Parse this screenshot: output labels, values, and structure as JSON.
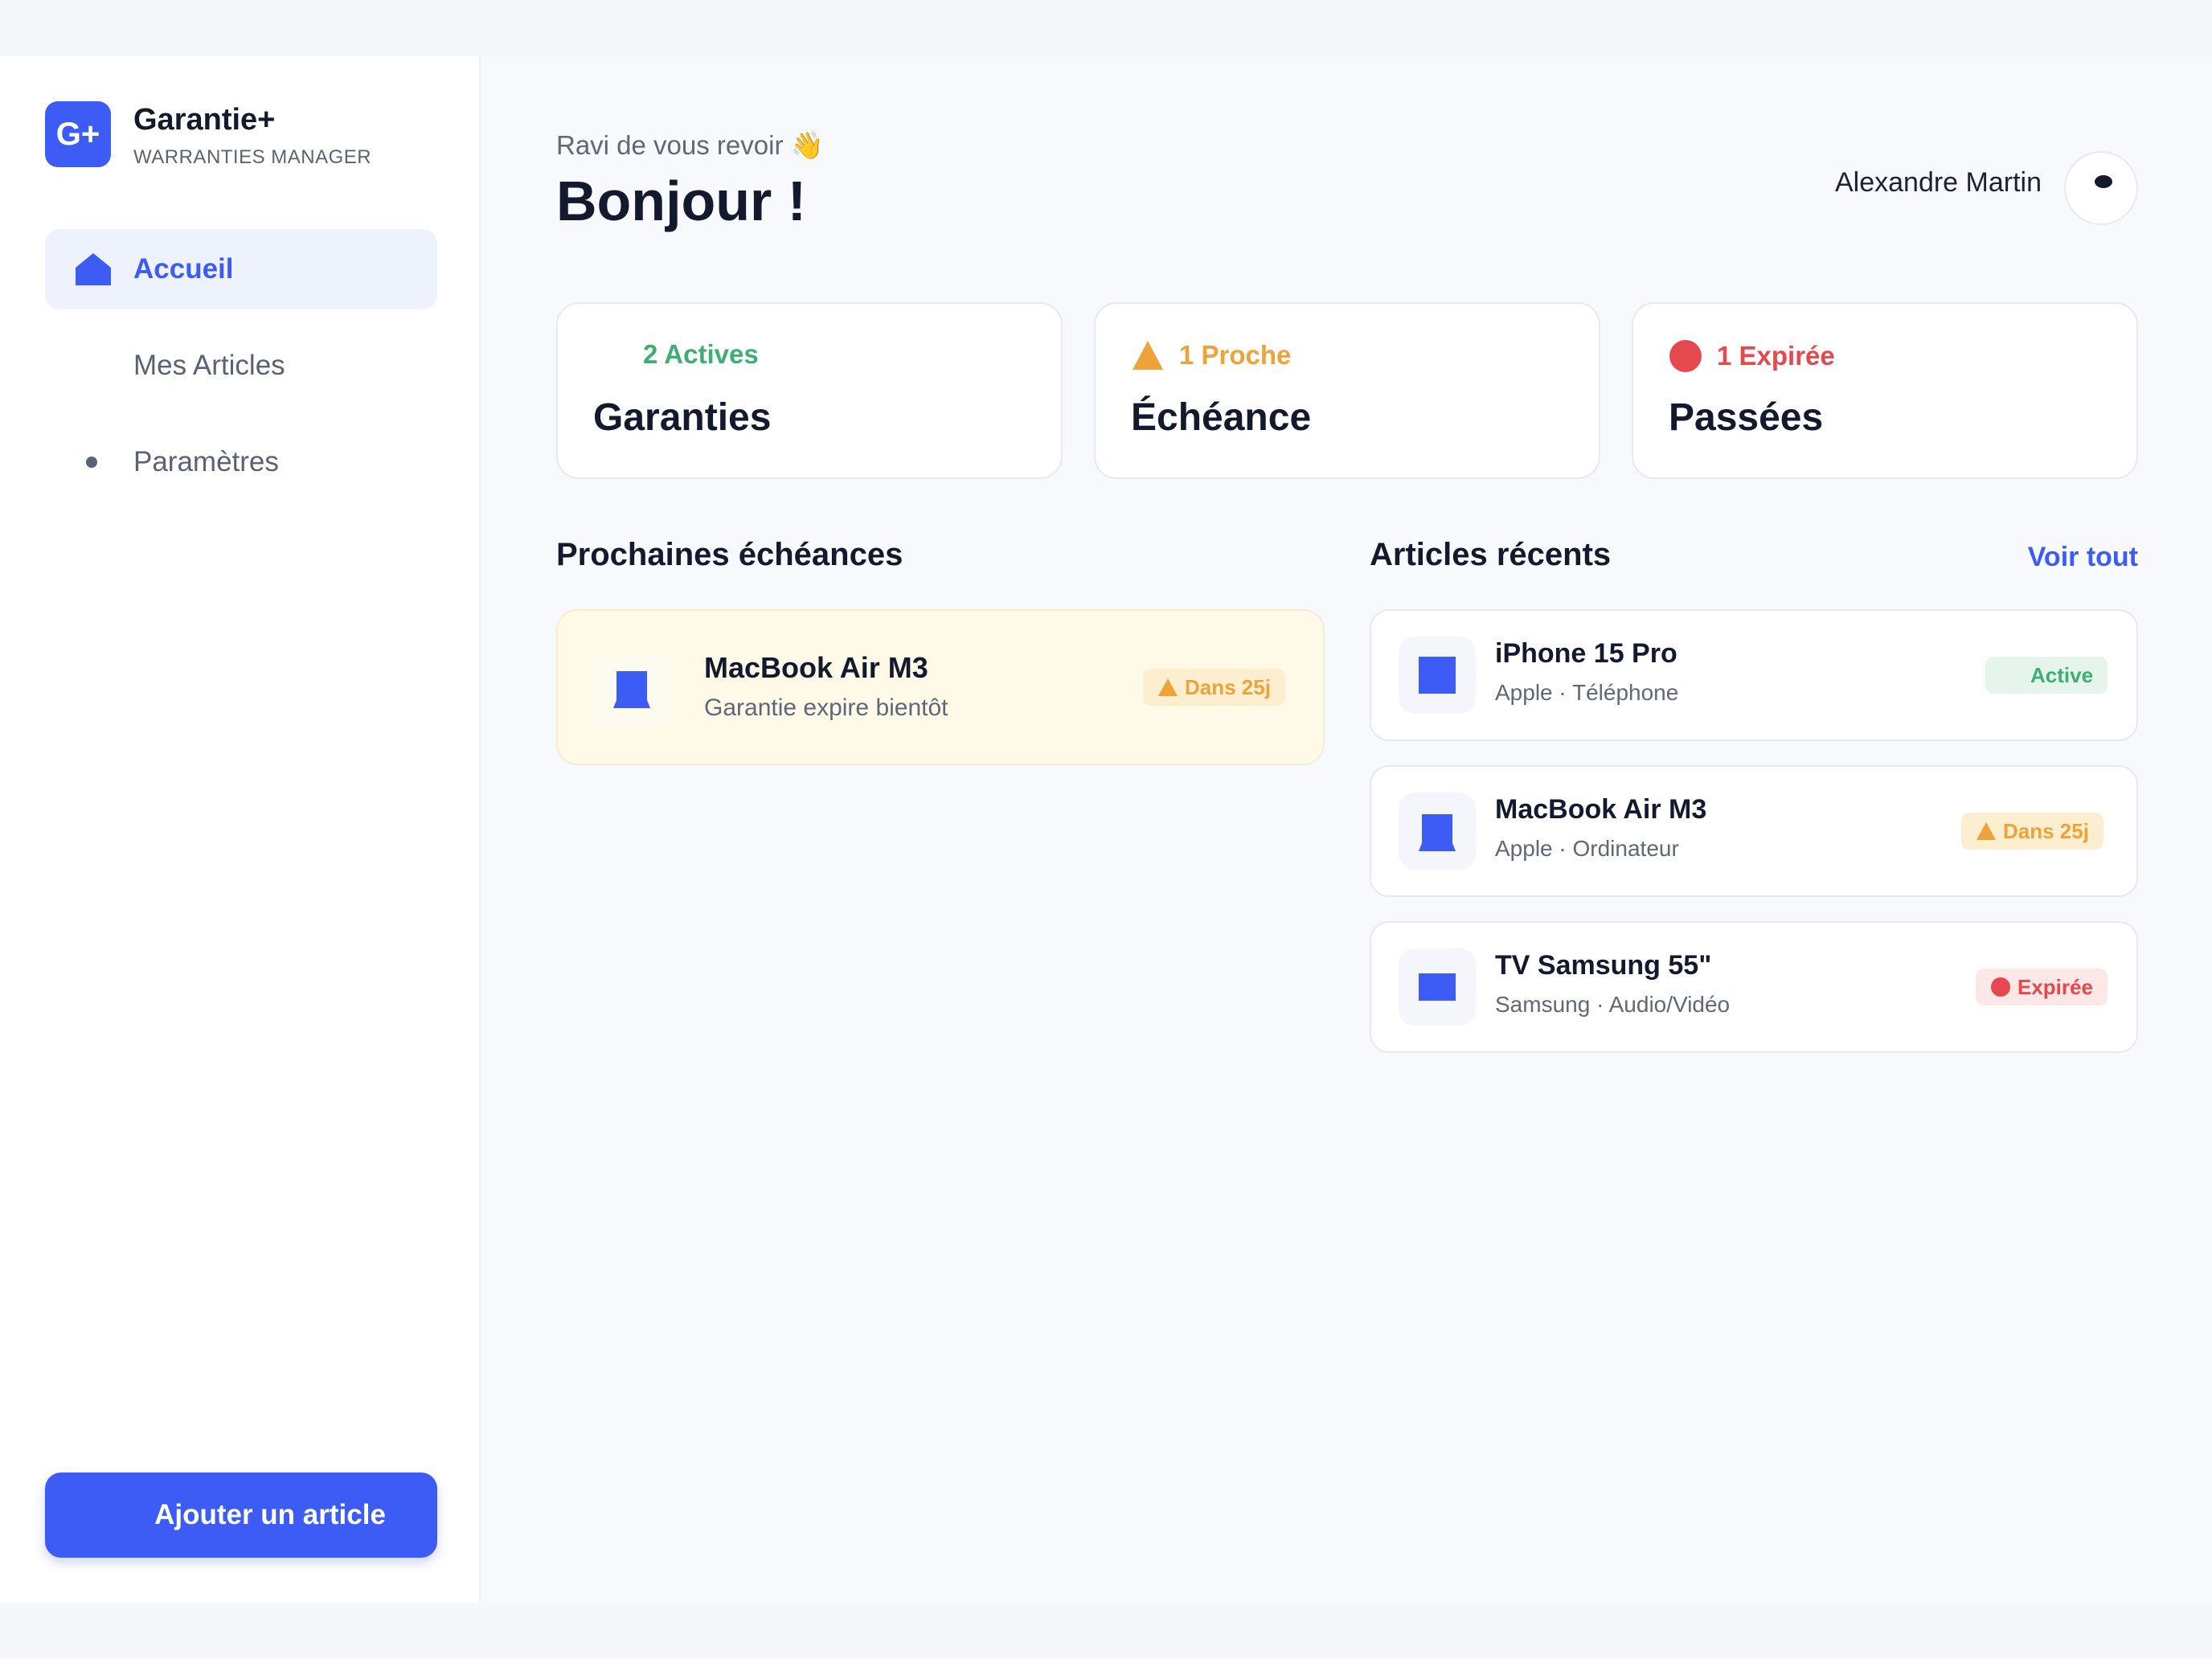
{
  "sidebar": {
    "logo_text": "G+",
    "brand_name": "Garantie+",
    "brand_sub": "WARRANTIES MANAGER",
    "items": [
      {
        "label": "Accueil",
        "icon": "home-icon"
      },
      {
        "label": "Mes Articles",
        "icon": ""
      },
      {
        "label": "Paramètres",
        "icon": "bullet-icon"
      }
    ],
    "add_button": "Ajouter un article"
  },
  "header": {
    "greeting_sub": "Ravi de vous revoir 👋",
    "greeting_title": "Bonjour !",
    "user_name": "Alexandre Martin"
  },
  "stats": [
    {
      "top": "2 Actives",
      "main": "Garanties",
      "color": "#3fae73",
      "icon": ""
    },
    {
      "top": "1 Proche",
      "main": "Échéance",
      "color": "#eea33a",
      "icon": "warning-icon"
    },
    {
      "top": "1 Expirée",
      "main": "Passées",
      "color": "#e5484d",
      "icon": "error-dot-icon"
    }
  ],
  "upcoming": {
    "title": "Prochaines échéances",
    "items": [
      {
        "name": "MacBook Air M3",
        "sub": "Garantie expire bientôt",
        "badge": "Dans 25j",
        "icon": "laptop-icon"
      }
    ]
  },
  "recent": {
    "title": "Articles récents",
    "see_all": "Voir tout",
    "items": [
      {
        "name": "iPhone 15 Pro",
        "sub": "Apple · Téléphone",
        "badge": "Active",
        "icon": "phone-icon"
      },
      {
        "name": "MacBook Air M3",
        "sub": "Apple · Ordinateur",
        "badge": "Dans 25j",
        "icon": "laptop-icon"
      },
      {
        "name": "TV Samsung 55\"",
        "sub": "Samsung · Audio/Vidéo",
        "badge": "Expirée",
        "icon": "tv-icon"
      }
    ]
  },
  "colors": {
    "accent": "#3d5cf5",
    "active": "#3fae73",
    "warning": "#eea33a",
    "expired": "#e5484d"
  }
}
